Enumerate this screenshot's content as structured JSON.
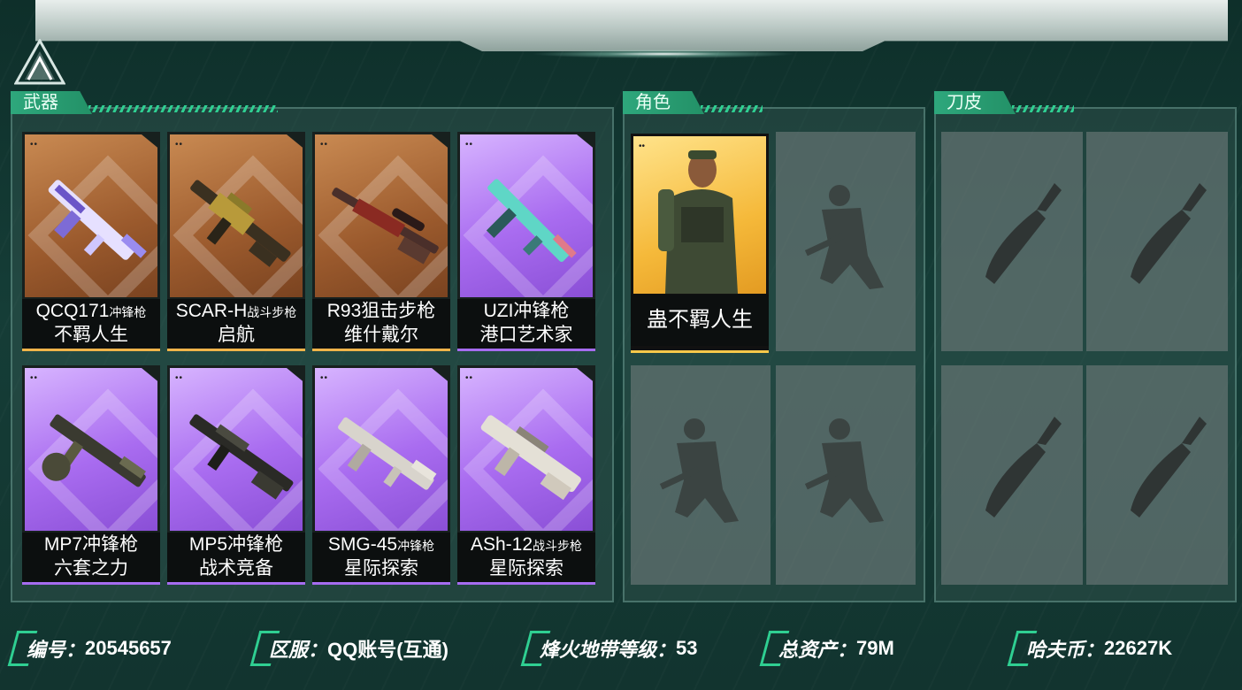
{
  "sections": {
    "weapons": "武器",
    "characters": "角色",
    "knives": "刀皮"
  },
  "weapons": [
    {
      "name": "QCQ171",
      "type": "冲锋枪",
      "skin": "不羁人生",
      "rarity": "orange"
    },
    {
      "name": "SCAR-H",
      "type": "战斗步枪",
      "skin": "启航",
      "rarity": "orange"
    },
    {
      "name": "R93狙击步枪",
      "type": "",
      "skin": "维什戴尔",
      "rarity": "orange"
    },
    {
      "name": "UZI冲锋枪",
      "type": "",
      "skin": "港口艺术家",
      "rarity": "purple"
    },
    {
      "name": "MP7冲锋枪",
      "type": "",
      "skin": "六套之力",
      "rarity": "purple"
    },
    {
      "name": "MP5冲锋枪",
      "type": "",
      "skin": "战术竞备",
      "rarity": "purple"
    },
    {
      "name": "SMG-45",
      "type": "冲锋枪",
      "skin": "星际探索",
      "rarity": "purple"
    },
    {
      "name": "ASh-12",
      "type": "战斗步枪",
      "skin": "星际探索",
      "rarity": "purple"
    }
  ],
  "characters": [
    {
      "name": "蛊不羁人生",
      "state": "owned"
    },
    {
      "name": "",
      "state": "empty"
    },
    {
      "name": "",
      "state": "empty"
    },
    {
      "name": "",
      "state": "empty"
    }
  ],
  "footer": {
    "id_label": "编号：",
    "id_value": "20545657",
    "server_label": "区服：",
    "server_value": "QQ账号(互通)",
    "level_label": "烽火地带等级：",
    "level_value": "53",
    "assets_label": "总资产：",
    "assets_value": "79M",
    "coin_label": "哈夫币：",
    "coin_value": "22627K"
  },
  "colors": {
    "accent": "#2fcf92",
    "gold": "#f6c84a",
    "orange": "#c98a52",
    "purple": "#a96cf0"
  }
}
